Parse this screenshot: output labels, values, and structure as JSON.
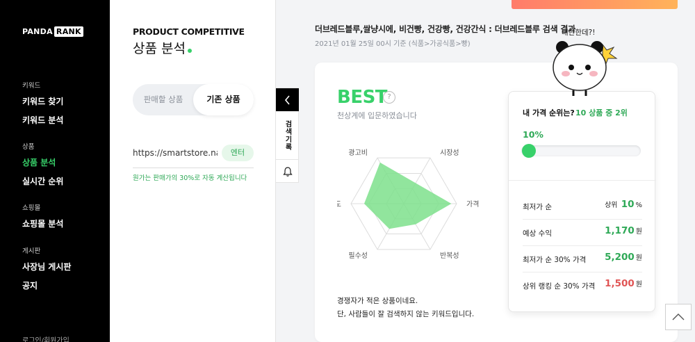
{
  "sidebar": {
    "logo_left": "PANDA",
    "logo_right": "RANK",
    "groups": [
      {
        "category": "키워드",
        "items": [
          "키워드 찾기",
          "키워드 분석"
        ]
      },
      {
        "category": "상품",
        "items": [
          "상품 분석",
          "실시간 순위"
        ]
      },
      {
        "category": "쇼핑몰",
        "items": [
          "쇼핑몰 분석"
        ]
      },
      {
        "category": "게시판",
        "items": [
          "사장님 게시판",
          "공지"
        ]
      }
    ],
    "footer": "로그인/회원가입"
  },
  "panel": {
    "title_en": "PRODUCT COMPETITIVE",
    "title_ko": "상품 분석",
    "toggle_left": "판매할 상품",
    "toggle_right": "기존 상품",
    "url_value": "https://smartstore.naver.com",
    "enter_label": "엔터",
    "note": "원가는 판매가의 30%로 자동 계산됩니다"
  },
  "tabs": {
    "history": "검색기록"
  },
  "result": {
    "title": "더브레드블루,쌀냥시에, 비건빵, 건강빵, 건강간식 : 더브레드블루 검색 결과",
    "date": "2021년 01월 25일 00시 기준 (식품>가공식품>빵)",
    "best": "BEST",
    "question": "?",
    "best_sub": "천상계에 입문하였습니다",
    "desc_line1": "경쟁자가 적은 상품이네요.",
    "desc_line2": "단, 사람들이 잘 검색하지 않는 키워드입니다."
  },
  "radar": {
    "axes": [
      "광고비",
      "시장성",
      "가격",
      "반복성",
      "필수성",
      "경쟁도"
    ],
    "values": [
      0.9,
      0.45,
      0.9,
      0.45,
      0.55,
      0.75
    ],
    "color": "#7ee08c"
  },
  "price": {
    "question": "내 가격 순위는?",
    "rank": "10 상품 중 2위",
    "percent_label": "10%",
    "percent_value": 0.06,
    "rows": [
      {
        "label": "최저가 순",
        "prefix": "상위 ",
        "value": "10",
        "unit": "%",
        "color": "#2fa957"
      },
      {
        "label": "예상 수익",
        "prefix": "",
        "value": "1,170",
        "unit": "원",
        "color": "#2fa957"
      },
      {
        "label": "최저가 순 30% 가격",
        "prefix": "",
        "value": "5,200",
        "unit": "원",
        "color": "#2fa957"
      },
      {
        "label": "상위 랭킹 순 30% 가격",
        "prefix": "",
        "value": "1,500",
        "unit": "원",
        "color": "#e05555"
      }
    ]
  },
  "mascot": {
    "speech": "대단한데?!"
  },
  "colors": {
    "accent": "#38d16a",
    "accent_text": "#2fa957",
    "danger": "#e05555"
  }
}
